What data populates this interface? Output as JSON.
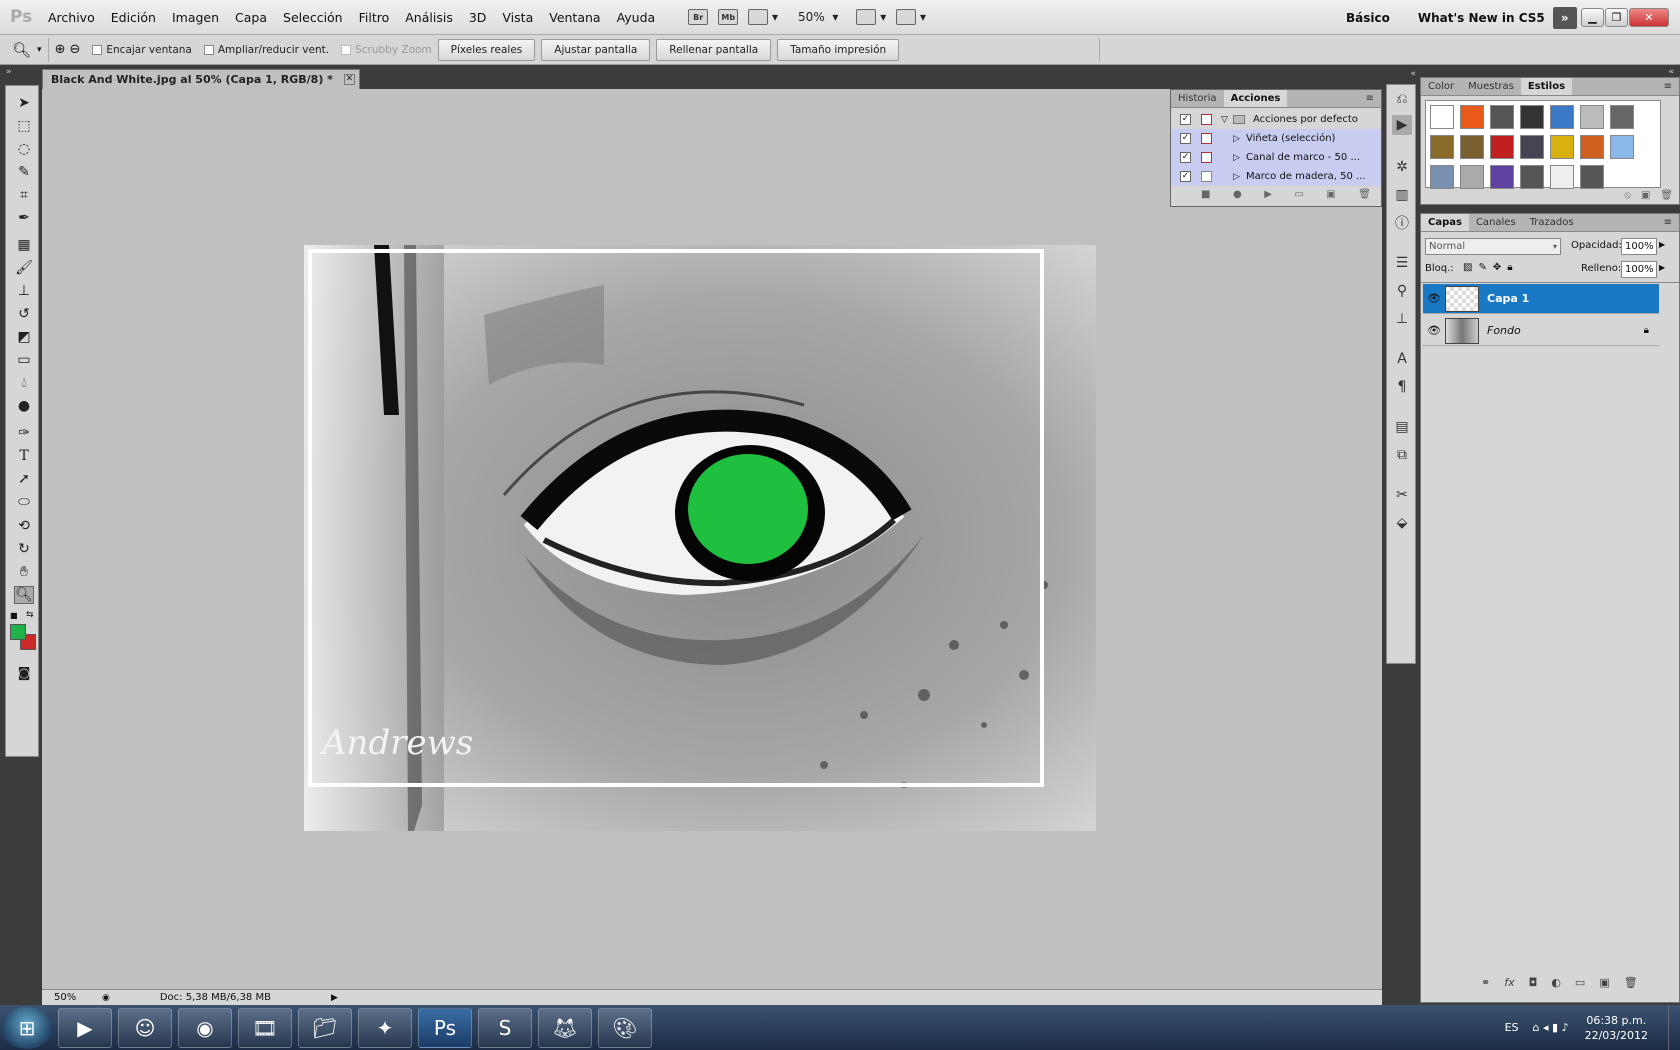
{
  "app": {
    "logo": "Ps"
  },
  "menu": [
    "Archivo",
    "Edición",
    "Imagen",
    "Capa",
    "Selección",
    "Filtro",
    "Análisis",
    "3D",
    "Vista",
    "Ventana",
    "Ayuda"
  ],
  "menubar": {
    "br_label": "Br",
    "mb_label": "Mb",
    "zoom": "50%",
    "workspace": "Básico",
    "whats_new": "What's New in CS5",
    "expand": "»"
  },
  "options": {
    "encajar": "Encajar ventana",
    "ampliar": "Ampliar/reducir vent.",
    "scrubby": "Scrubby Zoom",
    "pixeles": "Píxeles reales",
    "ajustar": "Ajustar pantalla",
    "rellenar": "Rellenar pantalla",
    "tamano": "Tamaño impresión"
  },
  "document": {
    "tab_title": "Black And White.jpg al 50% (Capa 1, RGB/8) *",
    "signature": "Andrews"
  },
  "status": {
    "zoom": "50%",
    "doc": "Doc: 5,38 MB/6,38 MB"
  },
  "colors": {
    "foreground": "#22b24c",
    "background": "#cc2a2a",
    "layer_selected": "#1a79c4",
    "iris": "#1fbf3f"
  },
  "actions_panel": {
    "tabs": [
      "Historia",
      "Acciones"
    ],
    "items": [
      {
        "label": "Acciones por defecto",
        "checked": true
      },
      {
        "label": "Viñeta (selección)",
        "checked": true
      },
      {
        "label": "Canal de marco - 50 ...",
        "checked": true
      },
      {
        "label": "Marco de madera, 50 ...",
        "checked": true
      }
    ]
  },
  "swatches_panel": {
    "tabs": [
      "Color",
      "Muestras",
      "Estilos"
    ]
  },
  "layers_panel": {
    "tabs": [
      "Capas",
      "Canales",
      "Trazados"
    ],
    "blend": "Normal",
    "opacity_label": "Opacidad:",
    "opacity": "100%",
    "lock_label": "Bloq.:",
    "fill_label": "Relleno:",
    "fill": "100%",
    "layers": [
      {
        "name": "Capa 1",
        "selected": true
      },
      {
        "name": "Fondo",
        "selected": false,
        "locked": true
      }
    ]
  },
  "taskbar": {
    "lang": "ES",
    "time": "06:38 p.m.",
    "date": "22/03/2012"
  }
}
